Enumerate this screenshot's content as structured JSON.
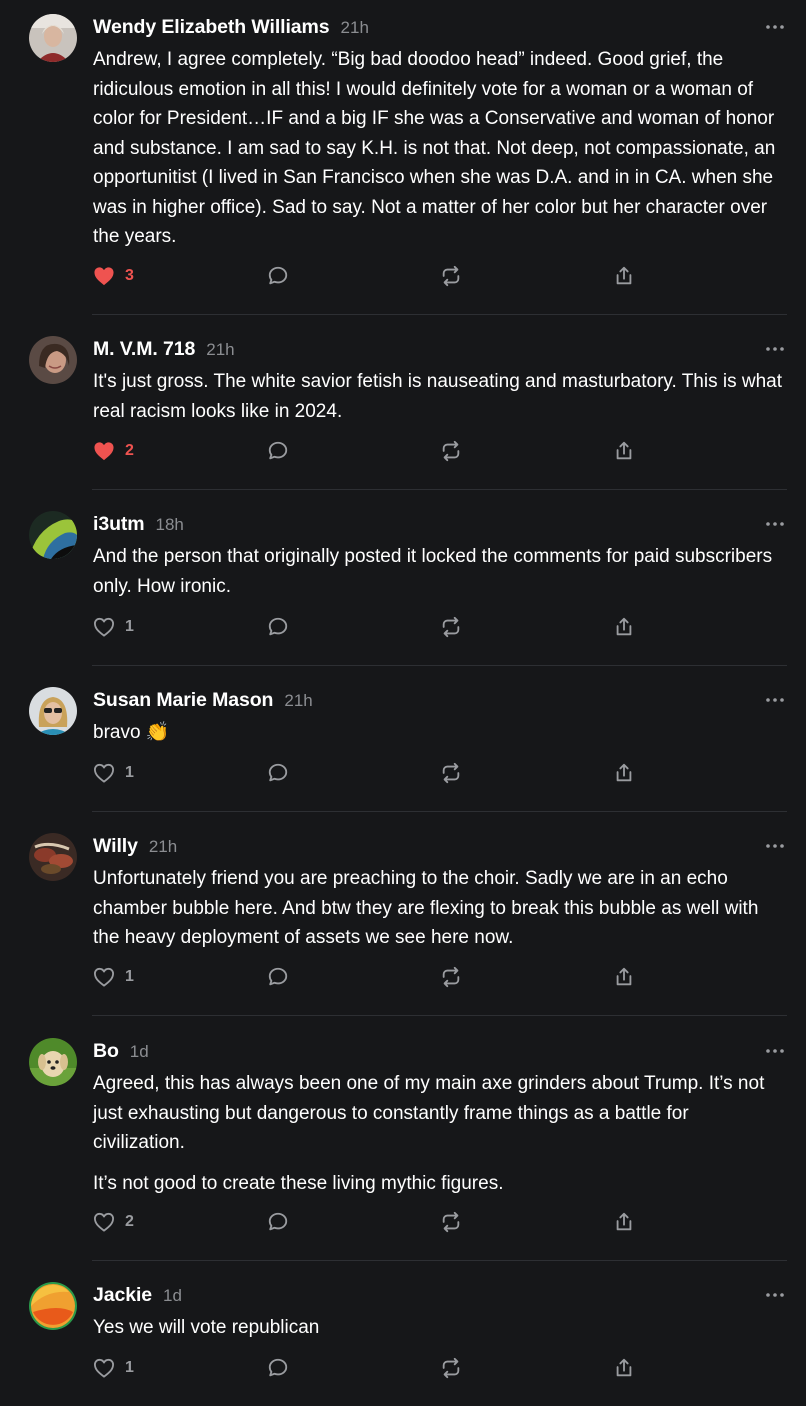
{
  "colors": {
    "background": "#161719",
    "text": "#ffffff",
    "muted": "#8b8d91",
    "liked": "#ef5350",
    "divider": "#2d2f33"
  },
  "icons": {
    "like": "heart-icon",
    "reply": "speech-bubble-icon",
    "restack": "restack-icon",
    "share": "share-icon",
    "more": "ellipsis-icon"
  },
  "comments": [
    {
      "author": "Wendy Elizabeth Williams",
      "time": "21h",
      "paragraphs": [
        "Andrew, I agree completely. “Big bad doodoo head” indeed. Good grief, the ridiculous emotion in all this! I would definitely vote for a woman or a woman of color for President…IF and a big IF she was a Conservative and woman of honor and substance. I am sad to say K.H. is not that. Not deep, not compassionate, an opportunitist (I lived in San Francisco when she was D.A. and in in CA. when she was in higher office). Sad to say. Not a matter of her color but her character over the years."
      ],
      "likes": "3",
      "liked": true
    },
    {
      "author": "M. V.M. 718",
      "time": "21h",
      "paragraphs": [
        "It's just gross. The white savior fetish is nauseating and masturbatory. This is what real racism looks like in 2024."
      ],
      "likes": "2",
      "liked": true
    },
    {
      "author": "i3utm",
      "time": "18h",
      "paragraphs": [
        "And the person that originally posted it locked the comments for paid subscribers only. How ironic."
      ],
      "likes": "1",
      "liked": false
    },
    {
      "author": "Susan Marie Mason",
      "time": "21h",
      "paragraphs": [
        "bravo 👏"
      ],
      "likes": "1",
      "liked": false
    },
    {
      "author": "Willy",
      "time": "21h",
      "paragraphs": [
        "Unfortunately friend you are preaching to the choir. Sadly we are in an echo chamber bubble here. And btw they are flexing to break this bubble as well with the heavy deployment of assets we see here now."
      ],
      "likes": "1",
      "liked": false
    },
    {
      "author": "Bo",
      "time": "1d",
      "paragraphs": [
        "Agreed, this has always been one of my main axe grinders about Trump. It’s not just exhausting but dangerous to constantly frame things as a battle for civilization.",
        "It’s not good to create these living mythic figures."
      ],
      "likes": "2",
      "liked": false
    },
    {
      "author": "Jackie",
      "time": "1d",
      "paragraphs": [
        "Yes we will vote republican"
      ],
      "likes": "1",
      "liked": false
    }
  ]
}
